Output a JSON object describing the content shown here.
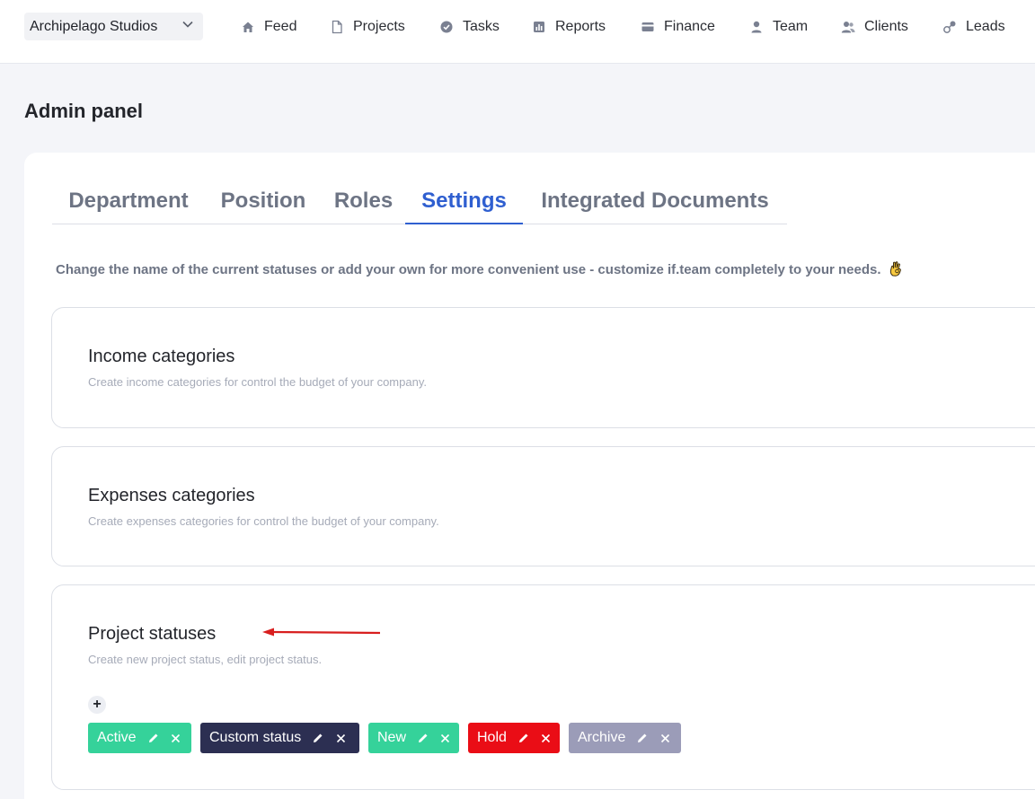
{
  "workspace": {
    "name": "Archipelago Studios"
  },
  "nav": [
    {
      "label": "Feed",
      "icon": "home-icon"
    },
    {
      "label": "Projects",
      "icon": "document-icon"
    },
    {
      "label": "Tasks",
      "icon": "check-circle-icon"
    },
    {
      "label": "Reports",
      "icon": "bar-chart-icon"
    },
    {
      "label": "Finance",
      "icon": "card-icon"
    },
    {
      "label": "Team",
      "icon": "user-icon"
    },
    {
      "label": "Clients",
      "icon": "users-icon"
    },
    {
      "label": "Leads",
      "icon": "leads-icon"
    }
  ],
  "page": {
    "title": "Admin panel"
  },
  "tabs": [
    {
      "label": "Department"
    },
    {
      "label": "Position"
    },
    {
      "label": "Roles"
    },
    {
      "label": "Settings",
      "active": true
    },
    {
      "label": "Integrated Documents"
    }
  ],
  "hint": "Change the name of the current statuses or add your own for more convenient use - customize if.team completely to your needs.",
  "sections": [
    {
      "title": "Income categories",
      "description": "Create income categories for control the budget of your company."
    },
    {
      "title": "Expenses categories",
      "description": "Create expenses categories for control the budget of your company."
    },
    {
      "title": "Project statuses",
      "description": "Create new project status, edit project status."
    }
  ],
  "add_button": {
    "label": "+"
  },
  "statuses": [
    {
      "label": "Active",
      "color": "#35d29a"
    },
    {
      "label": "Custom status",
      "color": "#2c2f52"
    },
    {
      "label": "New",
      "color": "#35d29a"
    },
    {
      "label": "Hold",
      "color": "#ea0d16"
    },
    {
      "label": "Archive",
      "color": "#9b9cb8"
    }
  ],
  "colors": {
    "accent": "#2f5fd0",
    "annotation_arrow": "#d81e1e"
  }
}
